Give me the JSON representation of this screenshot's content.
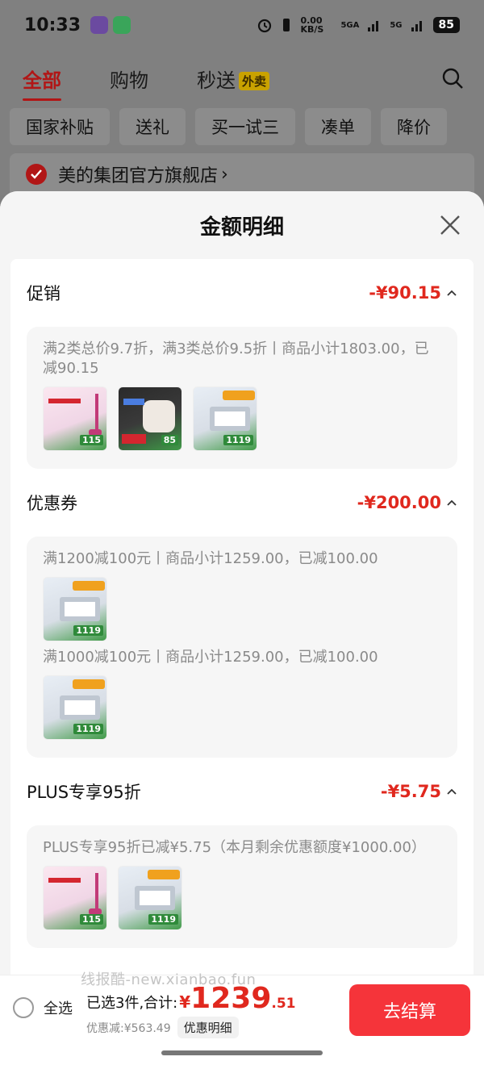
{
  "status_bar": {
    "time": "10:33",
    "speed": "0.00 KB/S",
    "net1": "5GA",
    "net2": "5G",
    "battery": "85"
  },
  "background_page": {
    "tabs": [
      {
        "label": "全部",
        "active": true
      },
      {
        "label": "购物",
        "active": false
      },
      {
        "label": "秒送",
        "active": false,
        "badge": "外卖"
      }
    ],
    "chips": [
      "国家补贴",
      "送礼",
      "买一试三",
      "凑单",
      "降价"
    ],
    "shop_name": "美的集团官方旗舰店",
    "shop_chevron": "›"
  },
  "sheet": {
    "title": "金额明细",
    "sections": [
      {
        "name": "促销",
        "amount": "-¥90.15",
        "desc": "满2类总价9.7折，满3类总价9.5折丨商品小计1803.00，已减90.15",
        "thumbs": [
          {
            "type": "vacuum",
            "price": "115"
          },
          {
            "type": "heater",
            "price": "85"
          },
          {
            "type": "dishwasher",
            "price": "1119"
          }
        ]
      },
      {
        "name": "优惠券",
        "amount": "-¥200.00",
        "groups": [
          {
            "desc": "满1200减100元丨商品小计1259.00，已减100.00",
            "thumbs": [
              {
                "type": "dishwasher",
                "price": "1119"
              }
            ]
          },
          {
            "desc": "满1000减100元丨商品小计1259.00，已减100.00",
            "thumbs": [
              {
                "type": "dishwasher",
                "price": "1119"
              }
            ]
          }
        ]
      },
      {
        "name": "PLUS专享95折",
        "amount": "-¥5.75",
        "desc": "PLUS专享95折已减¥5.75（本月剩余优惠额度¥1000.00）",
        "thumbs": [
          {
            "type": "vacuum",
            "price": "115"
          },
          {
            "type": "dishwasher",
            "price": "1119"
          }
        ]
      }
    ]
  },
  "bottom_bar": {
    "select_all": "全选",
    "selected_text": "已选3件,合计:",
    "currency": "¥",
    "total_int": "1239",
    "total_dec": ".51",
    "saved": "优惠减:¥563.49",
    "detail_button": "优惠明细",
    "checkout_button": "去结算",
    "watermark": "线报酷-new.xianbao.fun"
  },
  "colors": {
    "accent_red": "#e0281e",
    "checkout_red": "#f5343a",
    "dim_overlay": "#808080"
  }
}
